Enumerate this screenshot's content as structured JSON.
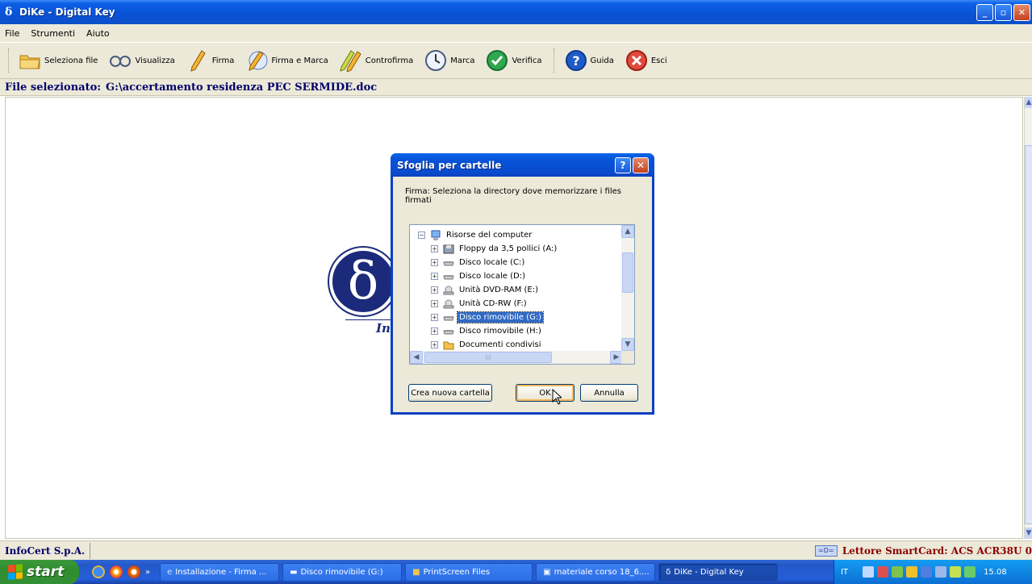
{
  "window": {
    "title": "DiKe - Digital Key",
    "app_icon": "δ",
    "minimize_label": "_",
    "maximize_label": "▫",
    "close_label": "✕"
  },
  "menu": {
    "items": [
      "File",
      "Strumenti",
      "Aiuto"
    ]
  },
  "toolbar": {
    "buttons": [
      {
        "label": "Seleziona file",
        "icon": "folder-icon"
      },
      {
        "label": "Visualizza",
        "icon": "glasses-icon"
      },
      {
        "label": "Firma",
        "icon": "pen-icon"
      },
      {
        "label": "Firma e Marca",
        "icon": "pen-stamp-icon"
      },
      {
        "label": "Controfirma",
        "icon": "countersign-icon"
      },
      {
        "label": "Marca",
        "icon": "clock-icon"
      },
      {
        "label": "Verifica",
        "icon": "check-icon"
      },
      {
        "label": "Guida",
        "icon": "help-icon"
      },
      {
        "label": "Esci",
        "icon": "exit-icon"
      }
    ]
  },
  "file_bar": {
    "label": "File selezionato:",
    "value": "G:\\accertamento residenza PEC SERMIDE.doc"
  },
  "logo": {
    "symbol": "δ",
    "text": "In"
  },
  "dialog": {
    "title": "Sfoglia per cartelle",
    "help_label": "?",
    "close_label": "✕",
    "description": "Firma: Seleziona la directory dove memorizzare i files firmati",
    "tree": [
      {
        "label": "Risorse del computer",
        "level": 0,
        "expander": "−",
        "icon": "computer-icon"
      },
      {
        "label": "Floppy da 3,5 pollici (A:)",
        "level": 1,
        "expander": "+",
        "icon": "floppy-icon"
      },
      {
        "label": "Disco locale (C:)",
        "level": 1,
        "expander": "+",
        "icon": "drive-icon"
      },
      {
        "label": "Disco locale (D:)",
        "level": 1,
        "expander": "+",
        "icon": "drive-icon"
      },
      {
        "label": "Unità DVD-RAM (E:)",
        "level": 1,
        "expander": "+",
        "icon": "cd-drive-icon"
      },
      {
        "label": "Unità CD-RW (F:)",
        "level": 1,
        "expander": "+",
        "icon": "cd-drive-icon"
      },
      {
        "label": "Disco rimovibile (G:)",
        "level": 1,
        "expander": "+",
        "icon": "drive-icon",
        "selected": true
      },
      {
        "label": "Disco rimovibile (H:)",
        "level": 1,
        "expander": "+",
        "icon": "drive-icon"
      },
      {
        "label": "Documenti condivisi",
        "level": 1,
        "expander": "+",
        "icon": "folder-icon"
      }
    ],
    "new_folder_label": "Crea nuova cartella",
    "ok_label": "OK",
    "cancel_label": "Annulla"
  },
  "status": {
    "left": "InfoCert S.p.A.",
    "reader": "Lettore SmartCard: ACS ACR38U 0"
  },
  "taskbar": {
    "start_label": "start",
    "more": "»",
    "tasks": [
      {
        "label": "Installazione - Firma ...",
        "icon": "ie-icon"
      },
      {
        "label": "Disco rimovibile (G:)",
        "icon": "drive-icon"
      },
      {
        "label": "PrintScreen Files",
        "icon": "folder-icon"
      },
      {
        "label": "materiale corso 18_6....",
        "icon": "explorer-icon"
      },
      {
        "label": "DiKe - Digital Key",
        "icon": "dike-icon",
        "active": true
      }
    ],
    "language": "IT",
    "clock": "15.08"
  }
}
